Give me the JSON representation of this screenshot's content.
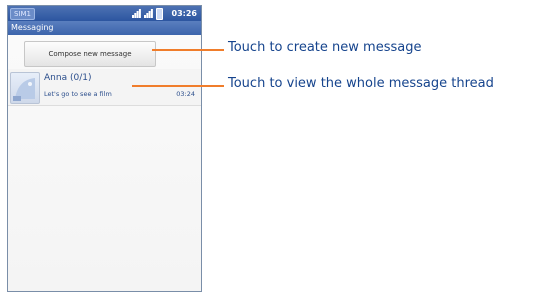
{
  "status_bar": {
    "sim_label": "SIM1",
    "time": "03:26",
    "icons": [
      "signal-icon",
      "signal-icon",
      "battery-icon"
    ]
  },
  "title_bar": {
    "title": "Messaging"
  },
  "compose_button": {
    "label": "Compose new message"
  },
  "threads": [
    {
      "name": "Anna",
      "count": "(0/1)",
      "preview": "Let's go to see a film",
      "time": "03:24",
      "icon": "contact-avatar-icon"
    }
  ],
  "callouts": {
    "compose": "Touch to create new message",
    "thread": "Touch to view the whole message thread"
  },
  "colors": {
    "callout_text": "#16448d",
    "leader_line": "#f07d2b",
    "status_bar": "#2c55a0"
  }
}
